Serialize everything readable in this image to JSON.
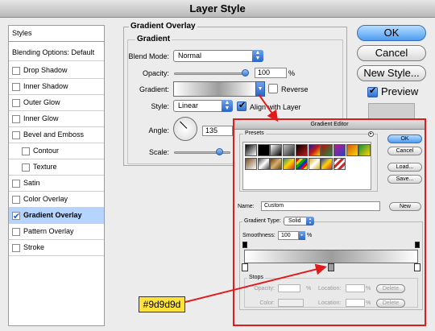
{
  "window": {
    "title": "Layer Style"
  },
  "styles_list": {
    "items": [
      {
        "label": "Styles",
        "checkbox": false,
        "checked": false,
        "selected": false,
        "indent": 0
      },
      {
        "label": "Blending Options: Default",
        "checkbox": false,
        "checked": false,
        "selected": false,
        "indent": 0
      },
      {
        "label": "Drop Shadow",
        "checkbox": true,
        "checked": false,
        "selected": false,
        "indent": 0
      },
      {
        "label": "Inner Shadow",
        "checkbox": true,
        "checked": false,
        "selected": false,
        "indent": 0
      },
      {
        "label": "Outer Glow",
        "checkbox": true,
        "checked": false,
        "selected": false,
        "indent": 0
      },
      {
        "label": "Inner Glow",
        "checkbox": true,
        "checked": false,
        "selected": false,
        "indent": 0
      },
      {
        "label": "Bevel and Emboss",
        "checkbox": true,
        "checked": false,
        "selected": false,
        "indent": 0
      },
      {
        "label": "Contour",
        "checkbox": true,
        "checked": false,
        "selected": false,
        "indent": 1
      },
      {
        "label": "Texture",
        "checkbox": true,
        "checked": false,
        "selected": false,
        "indent": 1
      },
      {
        "label": "Satin",
        "checkbox": true,
        "checked": false,
        "selected": false,
        "indent": 0
      },
      {
        "label": "Color Overlay",
        "checkbox": true,
        "checked": false,
        "selected": false,
        "indent": 0
      },
      {
        "label": "Gradient Overlay",
        "checkbox": true,
        "checked": true,
        "selected": true,
        "indent": 0
      },
      {
        "label": "Pattern Overlay",
        "checkbox": true,
        "checked": false,
        "selected": false,
        "indent": 0
      },
      {
        "label": "Stroke",
        "checkbox": true,
        "checked": false,
        "selected": false,
        "indent": 0
      }
    ]
  },
  "panel": {
    "outer_title": "Gradient Overlay",
    "inner_title": "Gradient",
    "blend_mode_label": "Blend Mode:",
    "blend_mode_value": "Normal",
    "opacity_label": "Opacity:",
    "opacity_value": "100",
    "opacity_unit": "%",
    "opacity_level": 1.0,
    "gradient_label": "Gradient:",
    "reverse_label": "Reverse",
    "reverse_checked": false,
    "style_label": "Style:",
    "style_value": "Linear",
    "align_label": "Align with Layer",
    "align_checked": true,
    "angle_label": "Angle:",
    "angle_value": "135",
    "scale_label": "Scale:"
  },
  "buttons": {
    "ok": "OK",
    "cancel": "Cancel",
    "new_style": "New Style...",
    "preview_label": "Preview",
    "preview_checked": true
  },
  "gradient_editor": {
    "title": "Gradient Editor",
    "presets_label": "Presets",
    "ok": "OK",
    "cancel": "Cancel",
    "load": "Load...",
    "save": "Save...",
    "name_label": "Name:",
    "name_value": "Custom",
    "new_button": "New",
    "gradient_type_label": "Gradient Type:",
    "gradient_type_value": "Solid",
    "smoothness_label": "Smoothness:",
    "smoothness_value": "100",
    "smoothness_unit": "%",
    "stops_label": "Stops",
    "opacity_label": "Opacity:",
    "opacity_unit": "%",
    "location_label": "Location:",
    "location_unit": "%",
    "delete_label": "Delete",
    "color_label": "Color:",
    "presets": [
      [
        "#000000",
        "#000000",
        "#000000",
        "#6f6f6f",
        "#000000",
        "#1b1b8f",
        "#b31010",
        "#b51e8a",
        "#cf5a10",
        "#1b8f3c"
      ],
      [
        "#7a4a1a",
        "#4a4a4a",
        "#6b3f10",
        "#2d8f7a",
        "#d6361a",
        "#cfae12",
        "#2b3fc7",
        "#cc2a2a"
      ]
    ]
  },
  "annotation": {
    "hex": "#9d9d9d"
  },
  "colors": {
    "accent": "#e11b1b",
    "selection": "#b5d5ff",
    "gradient_mid": "#9d9d9d"
  }
}
